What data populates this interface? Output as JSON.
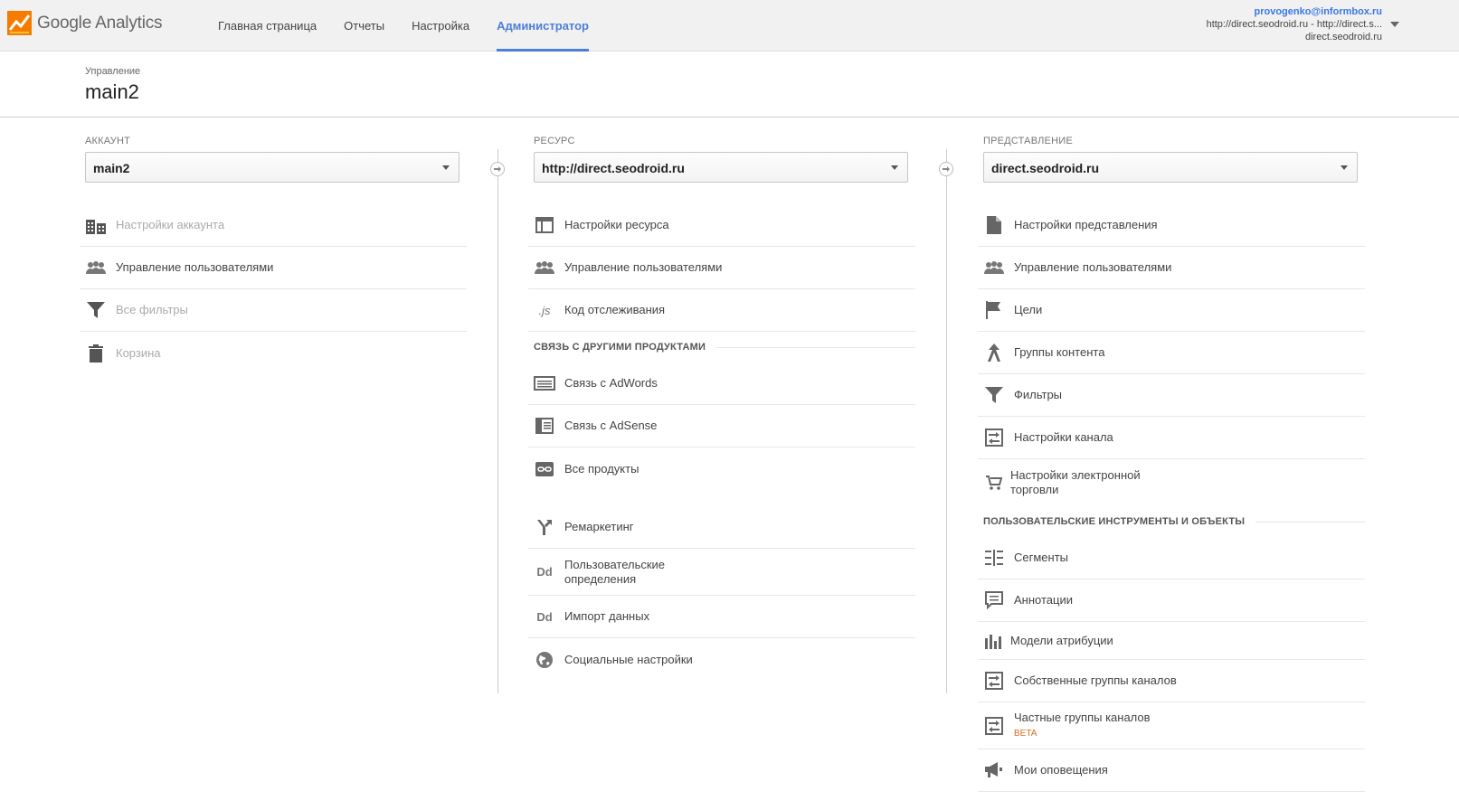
{
  "header": {
    "product": "Google Analytics",
    "nav": [
      "Главная страница",
      "Отчеты",
      "Настройка",
      "Администратор"
    ],
    "active_nav_index": 3,
    "account_email": "provogenko@informbox.ru",
    "account_property": "http://direct.seodroid.ru - http://direct.s...",
    "account_view": "direct.seodroid.ru"
  },
  "breadcrumb": {
    "label": "Управление",
    "title": "main2"
  },
  "account_col": {
    "label": "АККАУНТ",
    "selected": "main2",
    "items": [
      {
        "icon": "building-icon",
        "label": "Настройки аккаунта",
        "disabled": true
      },
      {
        "icon": "users-icon",
        "label": "Управление пользователями",
        "disabled": false
      },
      {
        "icon": "filter-icon",
        "label": "Все фильтры",
        "disabled": true
      },
      {
        "icon": "trash-icon",
        "label": "Корзина",
        "disabled": true
      }
    ]
  },
  "property_col": {
    "label": "РЕСУРС",
    "selected": "http://direct.seodroid.ru",
    "items": [
      {
        "icon": "window-icon",
        "label": "Настройки ресурса"
      },
      {
        "icon": "users-icon",
        "label": "Управление пользователями"
      },
      {
        "icon": "js-icon",
        "label": "Код отслеживания",
        "icon_text": ".js"
      }
    ],
    "section": "СВЯЗЬ С ДРУГИМИ ПРОДУКТАМИ",
    "products": [
      {
        "icon": "adwords-icon",
        "label": "Связь с AdWords"
      },
      {
        "icon": "adsense-icon",
        "label": "Связь с AdSense"
      },
      {
        "icon": "link-icon",
        "label": "Все продукты"
      }
    ],
    "more": [
      {
        "icon": "remarketing-icon",
        "label": "Ремаркетинг"
      },
      {
        "icon": "dd-icon",
        "label": "Пользовательские определения",
        "icon_text": "Dd"
      },
      {
        "icon": "dd-icon",
        "label": "Импорт данных",
        "icon_text": "Dd"
      },
      {
        "icon": "globe-icon",
        "label": "Социальные настройки"
      }
    ]
  },
  "view_col": {
    "label": "ПРЕДСТАВЛЕНИЕ",
    "selected": "direct.seodroid.ru",
    "items": [
      {
        "icon": "document-icon",
        "label": "Настройки представления"
      },
      {
        "icon": "users-icon",
        "label": "Управление пользователями"
      },
      {
        "icon": "flag-icon",
        "label": "Цели"
      },
      {
        "icon": "content-group-icon",
        "label": "Группы контента"
      },
      {
        "icon": "filter-icon",
        "label": "Фильтры"
      },
      {
        "icon": "channel-icon",
        "label": "Настройки канала"
      },
      {
        "icon": "cart-icon",
        "label": "Настройки электронной торговли"
      }
    ],
    "section": "ПОЛЬЗОВАТЕЛЬСКИЕ ИНСТРУМЕНТЫ И ОБЪЕКТЫ",
    "tools": [
      {
        "icon": "segments-icon",
        "label": "Сегменты"
      },
      {
        "icon": "annotation-icon",
        "label": "Аннотации"
      },
      {
        "icon": "attribution-icon",
        "label": "Модели атрибуции"
      },
      {
        "icon": "channel-icon",
        "label": "Собственные группы каналов"
      },
      {
        "icon": "channel-icon",
        "label": "Частные группы каналов",
        "badge": "BETA"
      },
      {
        "icon": "megaphone-icon",
        "label": "Мои оповещения"
      }
    ]
  }
}
